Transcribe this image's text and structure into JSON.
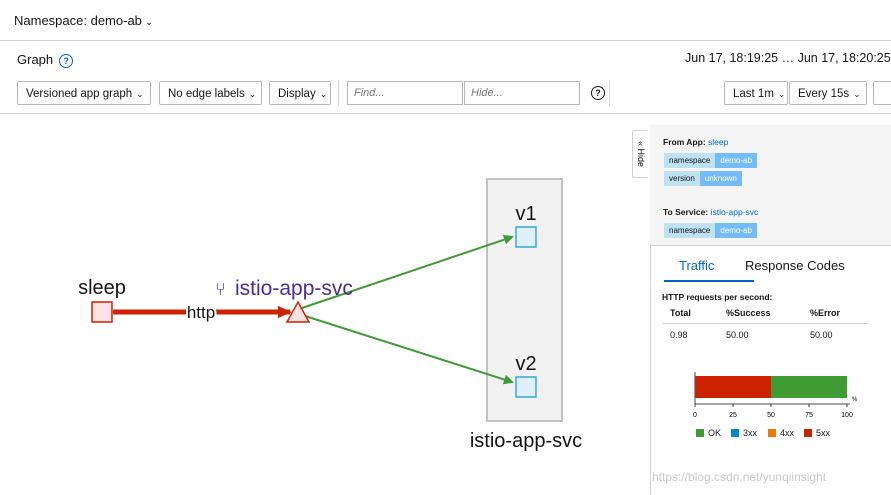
{
  "namespace_selector": {
    "label": "Namespace: demo-ab",
    "caret": "⌄"
  },
  "graph_title": "Graph",
  "help_glyph": "?",
  "time_range": "Jun 17, 18:19:25 … Jun 17, 18:20:25",
  "toolbar": {
    "graph_type": "Versioned app graph",
    "edge_labels": "No edge labels",
    "display": "Display",
    "find_placeholder": "Find...",
    "hide_placeholder": "Hide...",
    "duration": "Last 1m",
    "refresh": "Every 15s",
    "caret": "⌄"
  },
  "graph": {
    "source_node": "sleep",
    "edge_label": "http",
    "service_node": "istio-app-svc",
    "version_nodes": [
      "v1",
      "v2"
    ],
    "group_label": "istio-app-svc",
    "colors": {
      "error_edge": "#cc2200",
      "ok_edge": "#3f9c35",
      "service_purple": "#4a2c9b",
      "node_blue": "#39a5dc"
    }
  },
  "side_panel": {
    "hide_tab": "« Hide",
    "from_label": "From App:",
    "from_app": "sleep",
    "from_badges": [
      {
        "key": "namespace",
        "value": "demo-ab"
      },
      {
        "key": "version",
        "value": "unknown"
      }
    ],
    "to_label": "To Service:",
    "to_service": "istio-app-svc",
    "to_badges": [
      {
        "key": "namespace",
        "value": "demo-ab"
      }
    ],
    "tabs": [
      "Traffic",
      "Response Codes"
    ],
    "http_title": "HTTP requests per second:",
    "table_headers": [
      "Total",
      "%Success",
      "%Error"
    ],
    "table_row": [
      "0.98",
      "50.00",
      "50.00"
    ],
    "chart": {
      "success_pct": 50,
      "error_pct": 50,
      "ticks": [
        "0",
        "25",
        "50",
        "75",
        "100"
      ],
      "unit": "%",
      "legend": [
        {
          "label": "OK",
          "color": "#3f9c35"
        },
        {
          "label": "3xx",
          "color": "#0088ce"
        },
        {
          "label": "4xx",
          "color": "#ec7a08"
        },
        {
          "label": "5xx",
          "color": "#cc2200"
        }
      ]
    }
  },
  "watermark": "https://blog.csdn.net/yunqiinsight"
}
